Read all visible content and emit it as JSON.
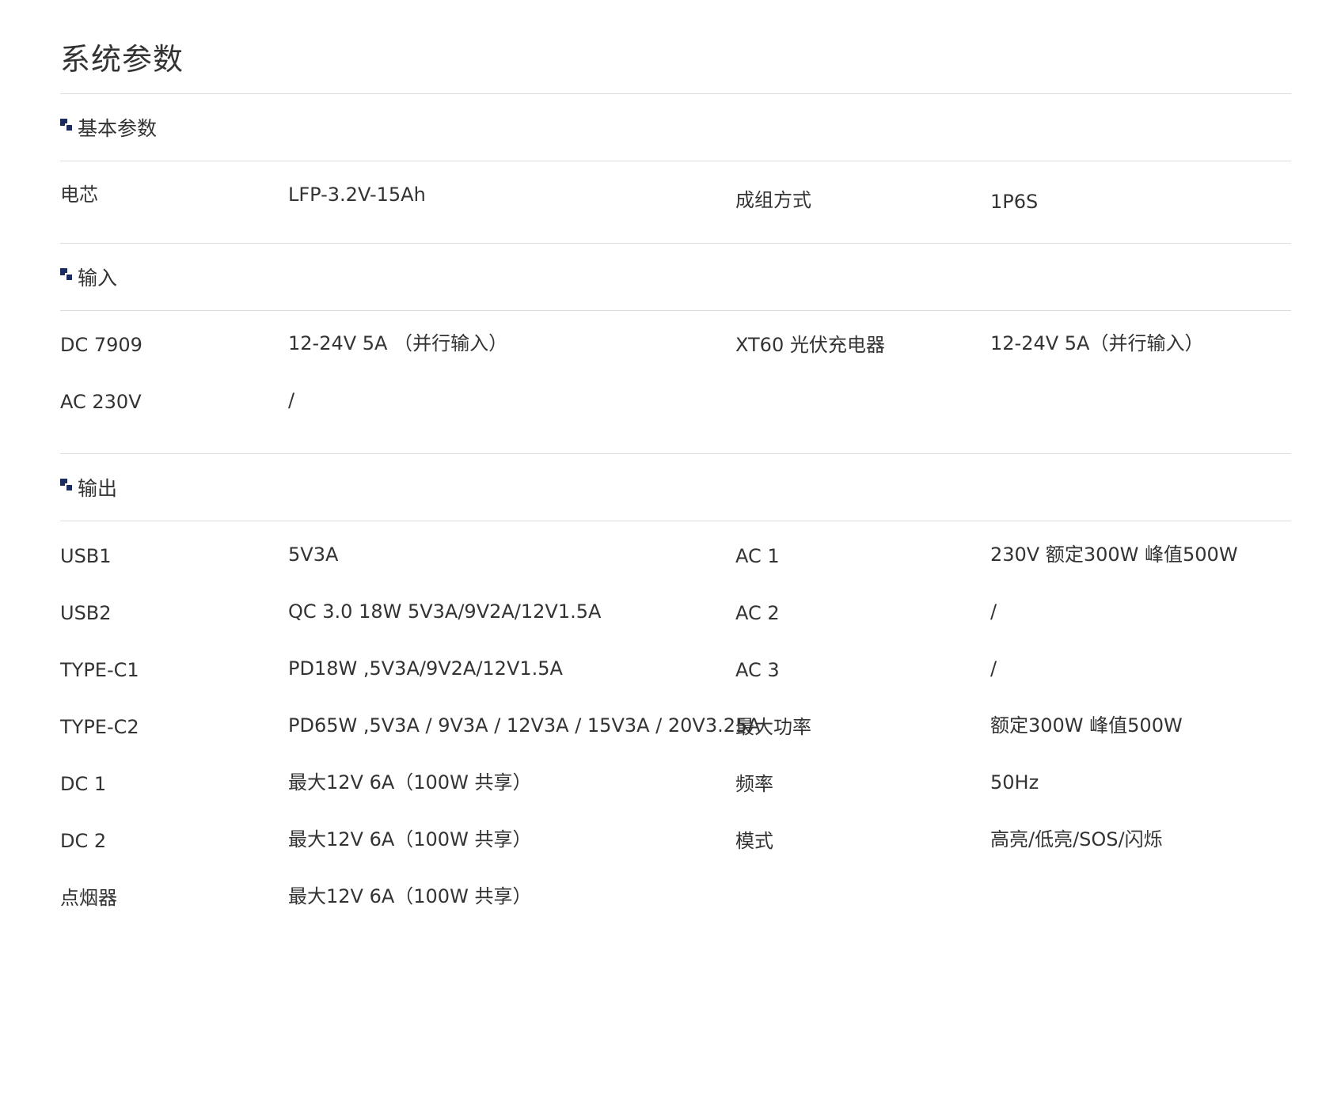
{
  "page": {
    "title": "系统参数"
  },
  "sections": {
    "basic": {
      "title": "基本参数",
      "rows": [
        {
          "k1": "电芯",
          "v1": "LFP-3.2V-15Ah",
          "k2": "成组方式",
          "v2": "1P6S"
        }
      ]
    },
    "input": {
      "title": "输入",
      "rows": [
        {
          "k1": "DC 7909",
          "v1": "12-24V 5A （并行输入）",
          "k2": "XT60 光伏充电器",
          "v2": "12-24V 5A（并行输入）"
        },
        {
          "k1": "AC 230V",
          "v1": "/",
          "k2": "",
          "v2": ""
        }
      ]
    },
    "output": {
      "title": "输出",
      "rows": [
        {
          "k1": "USB1",
          "v1": "5V3A",
          "k2": "AC 1",
          "v2": "230V 额定300W 峰值500W"
        },
        {
          "k1": "USB2",
          "v1": "QC 3.0 18W 5V3A/9V2A/12V1.5A",
          "k2": "AC 2",
          "v2": "/"
        },
        {
          "k1": "TYPE-C1",
          "v1": "PD18W ,5V3A/9V2A/12V1.5A",
          "k2": "AC 3",
          "v2": "/"
        },
        {
          "k1": "TYPE-C2",
          "v1": "PD65W ,5V3A / 9V3A / 12V3A / 15V3A / 20V3.25A",
          "k2": "最大功率",
          "v2": "额定300W 峰值500W"
        },
        {
          "k1": "DC 1",
          "v1": "最大12V 6A（100W 共享）",
          "k2": "频率",
          "v2": "50Hz"
        },
        {
          "k1": "DC 2",
          "v1": "最大12V 6A（100W  共享）",
          "k2": "模式",
          "v2": "高亮/低亮/SOS/闪烁"
        },
        {
          "k1": "点烟器",
          "v1": "最大12V 6A（100W  共享）",
          "k2": "",
          "v2": ""
        }
      ]
    }
  }
}
